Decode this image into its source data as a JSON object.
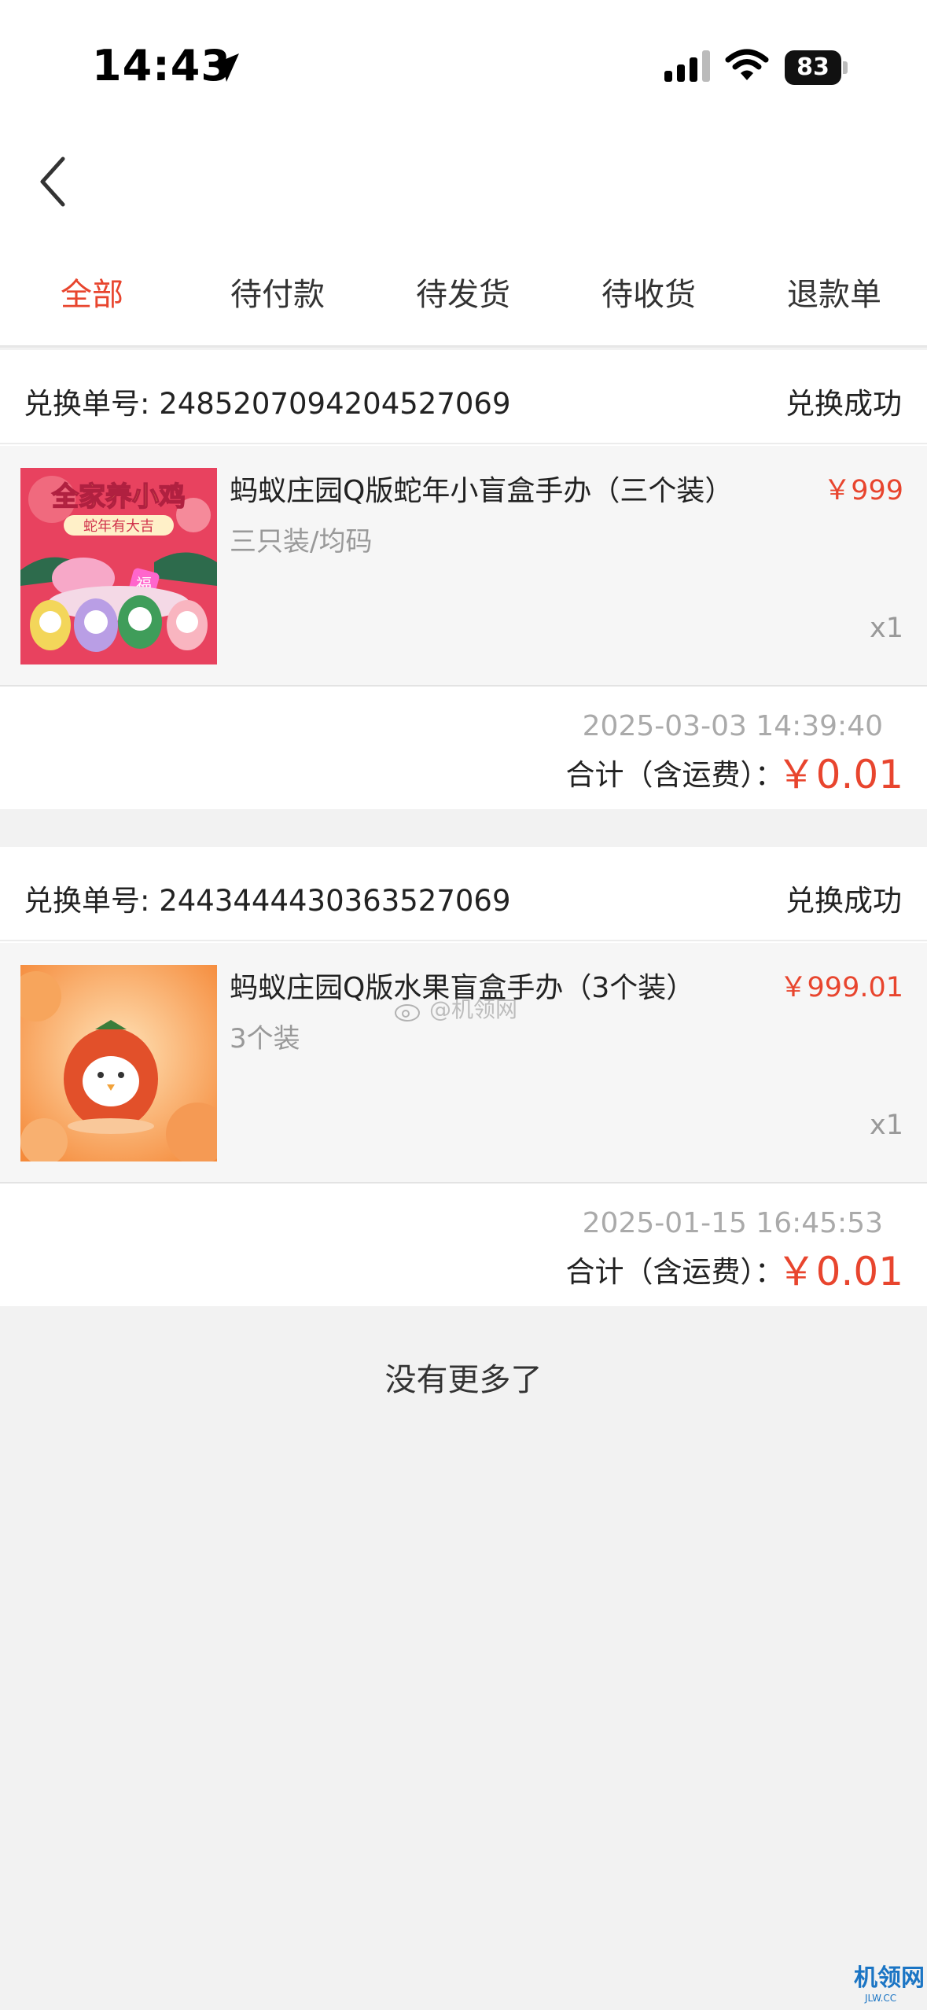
{
  "status_bar": {
    "time": "14:43",
    "battery": "83",
    "icons": [
      "location-arrow-icon",
      "signal-icon",
      "wifi-icon",
      "battery-icon"
    ]
  },
  "nav": {
    "back_icon": "chevron-left-icon"
  },
  "tabs": [
    {
      "label": "全部",
      "active": true
    },
    {
      "label": "待付款",
      "active": false
    },
    {
      "label": "待发货",
      "active": false
    },
    {
      "label": "待收货",
      "active": false
    },
    {
      "label": "退款单",
      "active": false
    }
  ],
  "orders": [
    {
      "order_no": "兑换单号: 2485207094204527069",
      "status": "兑换成功",
      "item": {
        "name": "蚂蚁庄园Q版蛇年小盲盒手办（三个装）",
        "price": "￥999",
        "spec": "三只装/均码",
        "qty": "x1",
        "image_text_line1": "全家养小鸡",
        "image_text_line2": "蛇年有大吉",
        "image_badge": "福"
      },
      "date": "2025-03-03 14:39:40",
      "total_label": "合计（含运费）：",
      "total_value": "￥0.01"
    },
    {
      "order_no": "兑换单号: 2443444430363527069",
      "status": "兑换成功",
      "item": {
        "name": "蚂蚁庄园Q版水果盲盒手办（3个装）",
        "price": "￥999.01",
        "spec": "3个装",
        "qty": "x1"
      },
      "date": "2025-01-15 16:45:53",
      "total_label": "合计（含运费）：",
      "total_value": "￥0.01"
    }
  ],
  "footer": {
    "no_more": "没有更多了"
  },
  "watermark": {
    "text": "@机领网",
    "corner_logo": "机领网",
    "corner_sub": "JLW.CC"
  },
  "colors": {
    "accent": "#e8452e",
    "background": "#f2f2f2",
    "item_bg": "#f6f6f6"
  }
}
